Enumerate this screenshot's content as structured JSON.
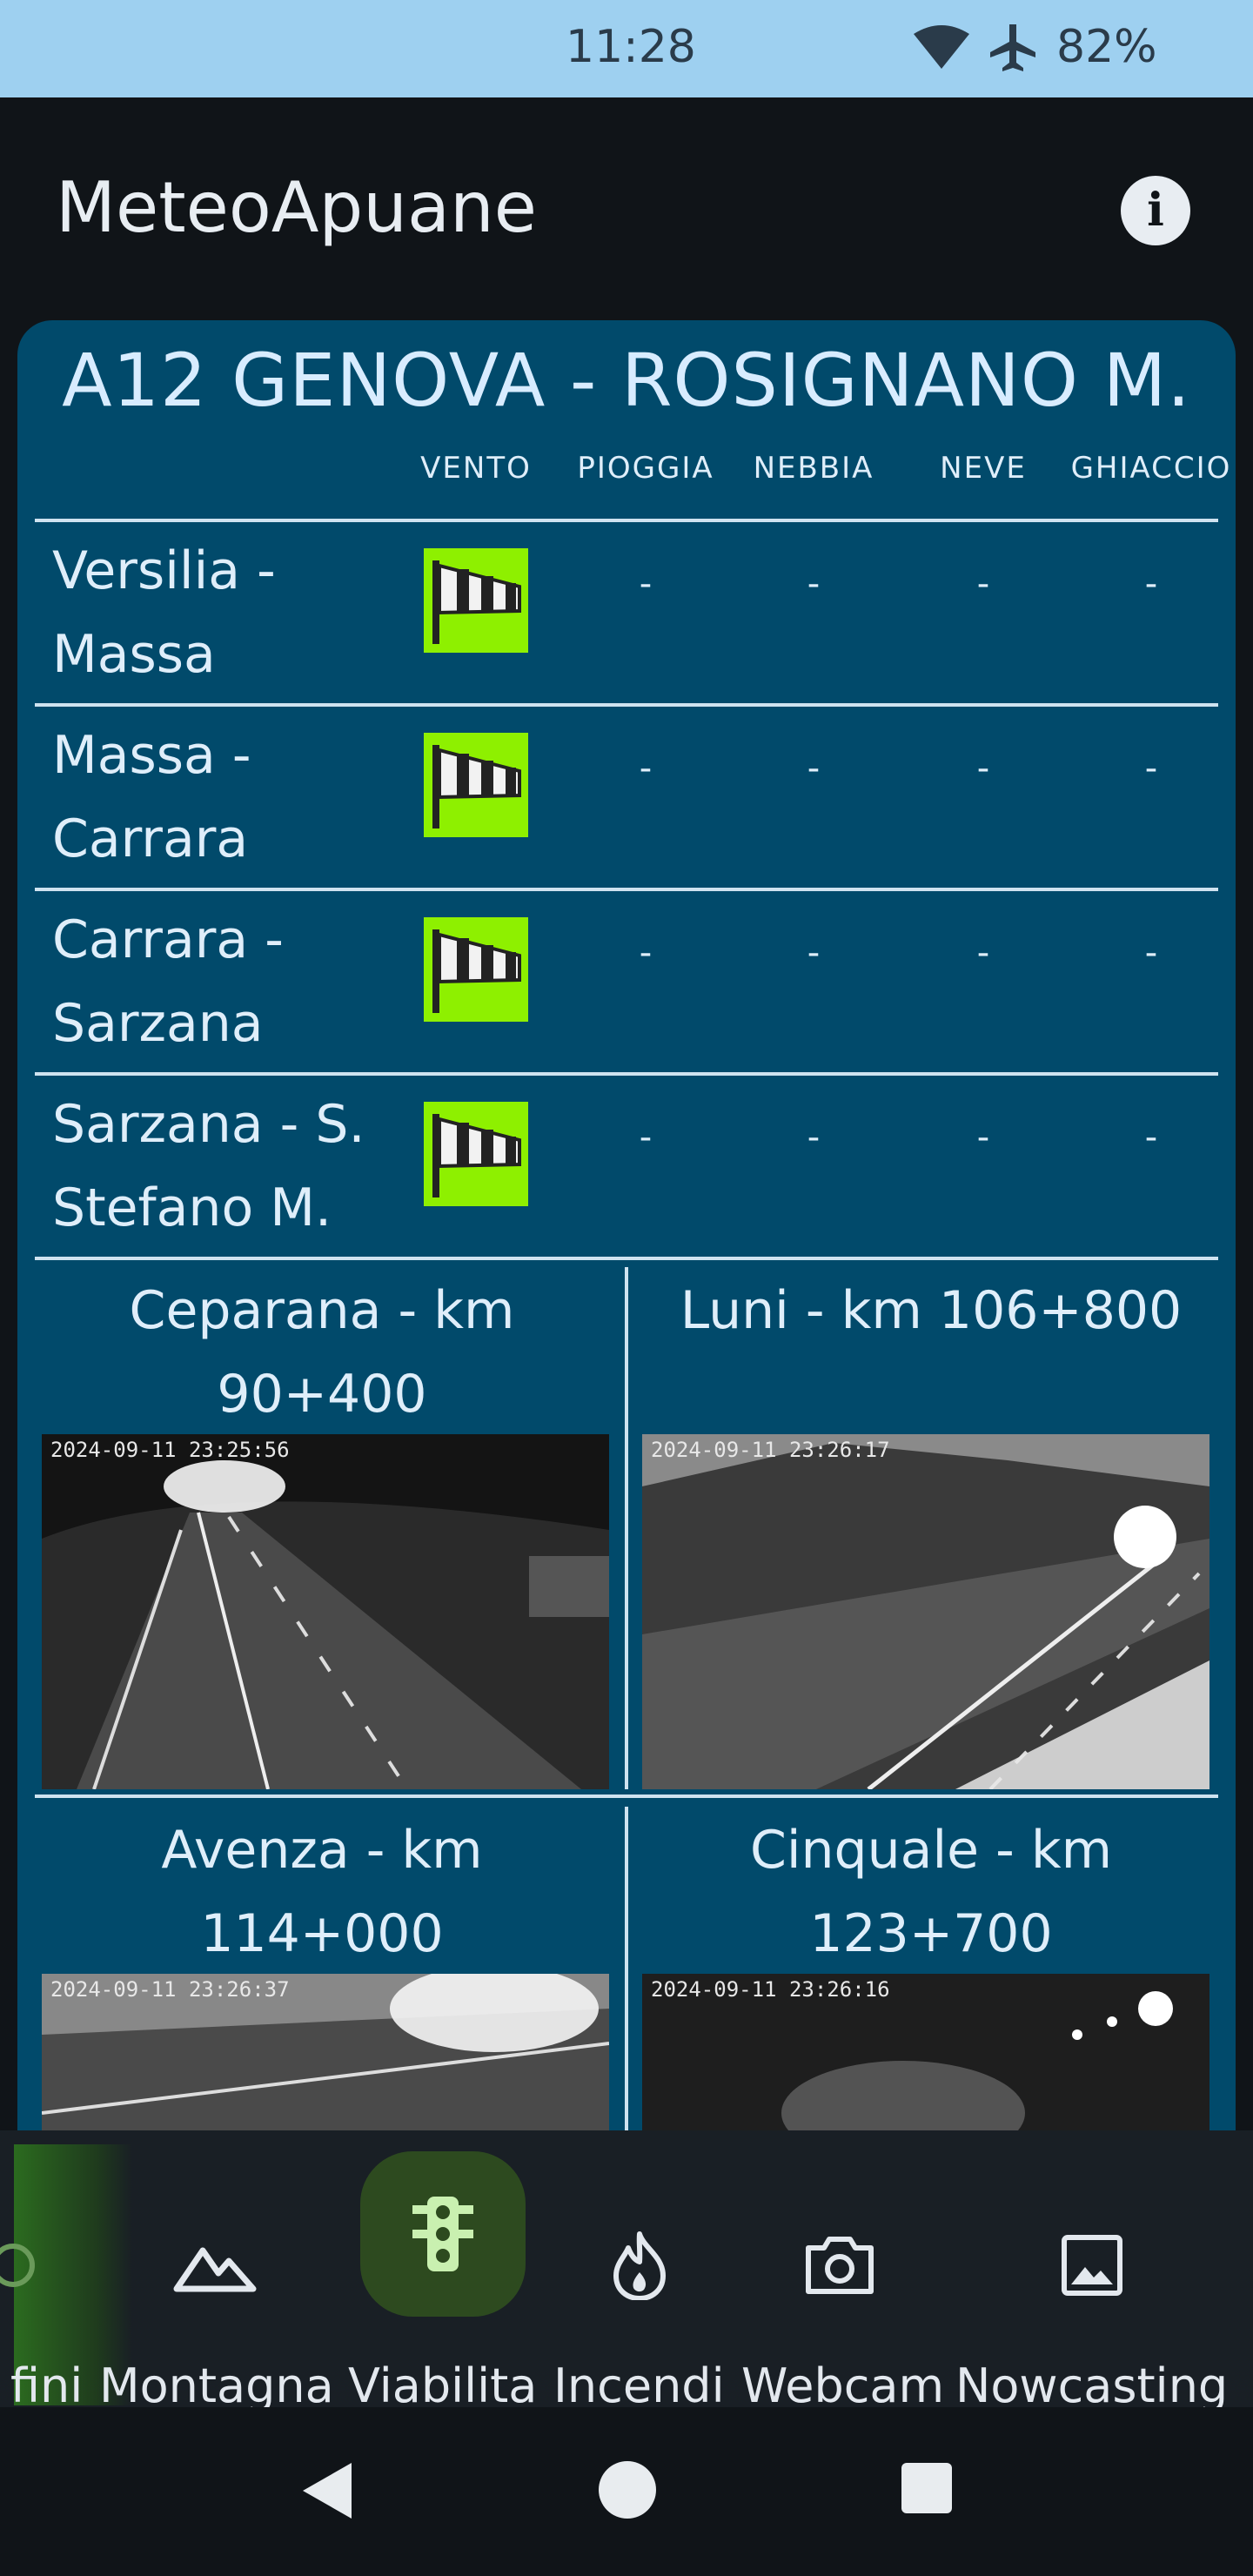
{
  "status_bar": {
    "time": "11:28",
    "battery": "82%",
    "icons": [
      "wifi-icon",
      "airplane-mode-icon"
    ]
  },
  "app_bar": {
    "title": "MeteoApuane",
    "info_icon": "info-icon",
    "info_glyph": "i"
  },
  "road": {
    "title": "A12 GENOVA - ROSIGNANO M.",
    "columns": [
      "VENTO",
      "PIOGGIA",
      "NEBBIA",
      "NEVE",
      "GHIACCIO"
    ],
    "segments": [
      {
        "line1": "Versilia -",
        "line2": "Massa",
        "wind_icon": "windsock-icon",
        "pioggia": "-",
        "nebbia": "-",
        "neve": "-",
        "ghiaccio": "-"
      },
      {
        "line1": "Massa -",
        "line2": "Carrara",
        "wind_icon": "windsock-icon",
        "pioggia": "-",
        "nebbia": "-",
        "neve": "-",
        "ghiaccio": "-"
      },
      {
        "line1": "Carrara -",
        "line2": "Sarzana",
        "wind_icon": "windsock-icon",
        "pioggia": "-",
        "nebbia": "-",
        "neve": "-",
        "ghiaccio": "-"
      },
      {
        "line1": "Sarzana - S.",
        "line2": "Stefano M.",
        "wind_icon": "windsock-icon",
        "pioggia": "-",
        "nebbia": "-",
        "neve": "-",
        "ghiaccio": "-"
      }
    ],
    "cameras": [
      {
        "line1": "Ceparana - km",
        "line2": "90+400",
        "timestamp": "2024-09-11 23:25:56"
      },
      {
        "line1": "Luni - km 106+800",
        "line2": "",
        "timestamp": "2024-09-11 23:26:17"
      },
      {
        "line1": "Avenza - km 114+000",
        "line2": "",
        "timestamp": "2024-09-11 23:26:37"
      },
      {
        "line1": "Cinquale - km",
        "line2": "123+700",
        "timestamp": "2024-09-11 23:26:16"
      }
    ]
  },
  "bottom_nav": {
    "items": [
      {
        "label": "fini",
        "icon": "partial-icon",
        "selected": false
      },
      {
        "label": "Montagna",
        "icon": "mountain-icon",
        "selected": false
      },
      {
        "label": "Viabilita",
        "icon": "traffic-light-icon",
        "selected": true
      },
      {
        "label": "Incendi",
        "icon": "fire-icon",
        "selected": false
      },
      {
        "label": "Webcam",
        "icon": "camera-icon",
        "selected": false
      },
      {
        "label": "Nowcasting",
        "icon": "image-icon",
        "selected": false
      }
    ]
  },
  "system_nav": {
    "icons": [
      "back-icon",
      "home-icon",
      "recents-icon"
    ]
  },
  "colors": {
    "card": "#014a6b",
    "windsock_bg": "#8ef000",
    "nav_selected": "#2d4a1f",
    "status_bar": "#9ed0f0"
  }
}
